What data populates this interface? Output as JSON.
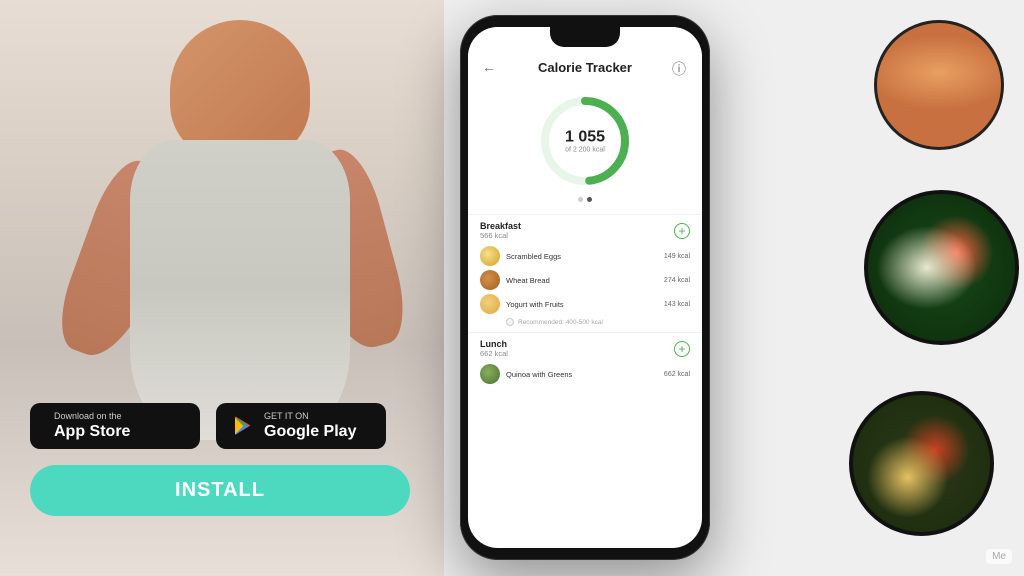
{
  "page": {
    "bg_color": "#f0f0f0",
    "watermark": "Mе"
  },
  "app": {
    "title": "Calorie Tracker",
    "back_icon": "←",
    "info_icon": "ⓘ",
    "calorie_current": "1 055",
    "calorie_total": "of 2 200 kcal",
    "calorie_progress": 47.9,
    "dots": [
      "inactive",
      "active"
    ],
    "ring_color": "#4caf50",
    "ring_bg_color": "#e8f5e9",
    "meals": [
      {
        "name": "Breakfast",
        "kcal": "566 kcal",
        "items": [
          {
            "name": "Scrambled Eggs",
            "kcal": "149 kcal",
            "icon_type": "eggs"
          },
          {
            "name": "Wheat Bread",
            "kcal": "274 kcal",
            "icon_type": "bread"
          },
          {
            "name": "Yogurt with Fruits",
            "kcal": "143 kcal",
            "icon_type": "yogurt"
          }
        ],
        "recommended": "Recommended: 400-500 kcal"
      },
      {
        "name": "Lunch",
        "kcal": "662 kcal",
        "items": [
          {
            "name": "Quinoa with Greens",
            "kcal": "662 kcal",
            "icon_type": "quinoa"
          }
        ]
      }
    ]
  },
  "store_buttons": {
    "app_store": {
      "small_text": "Download on the",
      "large_text": "App Store",
      "icon": ""
    },
    "google_play": {
      "small_text": "GET IT ON",
      "large_text": "Google Play",
      "icon": "▶"
    }
  },
  "install_button": {
    "label": "INSTALL"
  },
  "food_bowls": [
    {
      "id": "bowl-top-right",
      "description": "Salmon with greens"
    },
    {
      "id": "bowl-middle-right",
      "description": "Shrimp salad"
    },
    {
      "id": "bowl-bottom-right",
      "description": "Grain bowl"
    }
  ]
}
